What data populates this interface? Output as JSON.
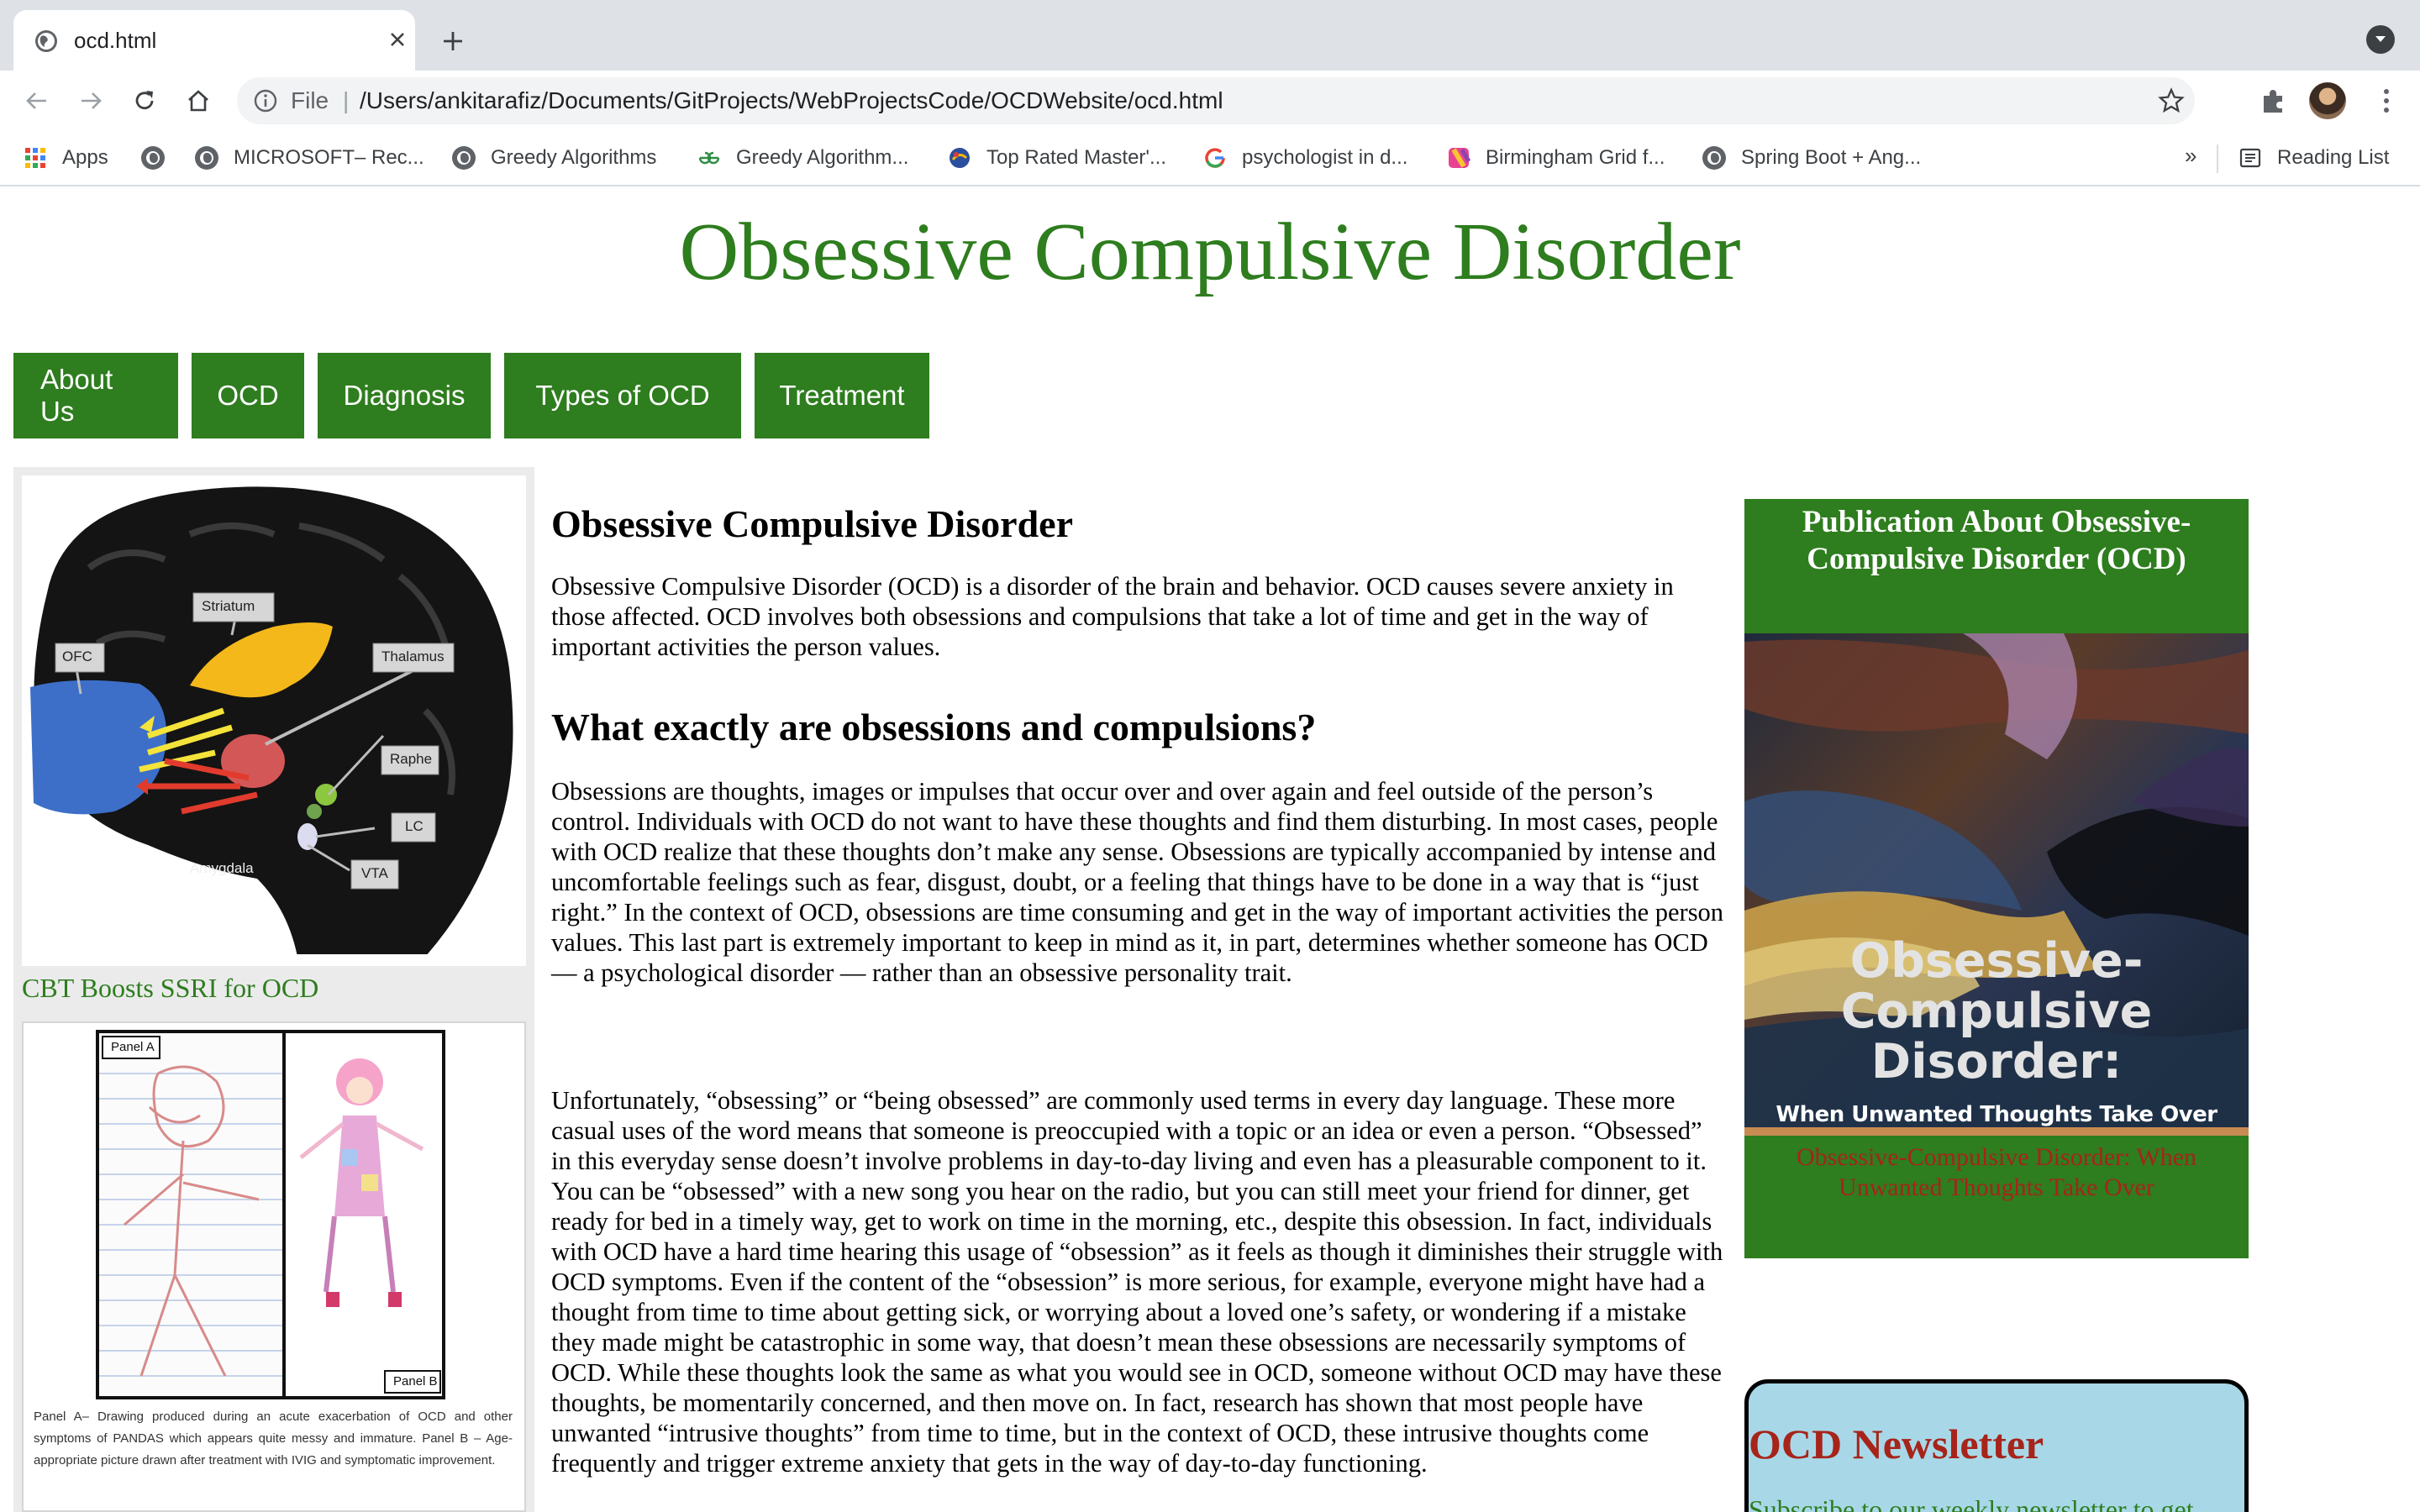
{
  "browser": {
    "tab_title": "ocd.html",
    "address_scheme": "File",
    "address_url": "/Users/ankitarafiz/Documents/GitProjects/WebProjectsCode/OCDWebsite/ocd.html",
    "bookmarks": [
      {
        "label": "Apps",
        "icon": "apps-grid-icon"
      },
      {
        "label": "",
        "icon": "globe-icon"
      },
      {
        "label": "MICROSOFT– Rec...",
        "icon": "globe-icon"
      },
      {
        "label": "Greedy Algorithms",
        "icon": "globe-icon"
      },
      {
        "label": "Greedy Algorithm...",
        "icon": "geeksforgeeks-icon"
      },
      {
        "label": "Top Rated Master'...",
        "icon": "site-icon"
      },
      {
        "label": "psychologist in d...",
        "icon": "google-icon"
      },
      {
        "label": "Birmingham Grid f...",
        "icon": "site-icon"
      },
      {
        "label": "Spring Boot + Ang...",
        "icon": "globe-icon"
      }
    ],
    "bookmarks_more": "»",
    "reading_list": "Reading List"
  },
  "page": {
    "site_title": "Obsessive Compulsive Disorder",
    "nav": [
      "About Us",
      "OCD",
      "Diagnosis",
      "Types of OCD",
      "Treatment"
    ],
    "left": {
      "figure1_labels": {
        "ofc": "OFC",
        "striatum": "Striatum",
        "thalamus": "Thalamus",
        "raphe": "Raphe",
        "lc": "LC",
        "vta": "VTA",
        "amygdala": "Amygdala"
      },
      "figure1_caption": "CBT Boosts SSRI for OCD",
      "figure2_labels": {
        "panel_a": "Panel A",
        "panel_b": "Panel B"
      },
      "figure2_caption": "Panel A– Drawing produced during an acute exacerbation of OCD and other symptoms of PANDAS which appears quite messy and immature. Panel B – Age-appropriate picture drawn after treatment with IVIG and symptomatic improvement."
    },
    "main": {
      "heading1": "Obsessive Compulsive Disorder",
      "para1": "Obsessive Compulsive Disorder (OCD) is a disorder of the brain and behavior. OCD causes severe anxiety in those affected. OCD involves both obsessions and compulsions that take a lot of time and get in the way of important activities the person values.",
      "heading2": "What exactly are obsessions and compulsions?",
      "para2": "Obsessions are thoughts, images or impulses that occur over and over again and feel outside of the person’s control. Individuals with OCD do not want to have these thoughts and find them disturbing. In most cases, people with OCD realize that these thoughts don’t make any sense. Obsessions are typically accompanied by intense and uncomfortable feelings such as fear, disgust, doubt, or a feeling that things have to be done in a way that is “just right.” In the context of OCD, obsessions are time consuming and get in the way of important activities the person values. This last part is extremely important to keep in mind as it, in part, determines whether someone has OCD — a psychological disorder — rather than an obsessive personality trait.",
      "para3": "Unfortunately, “obsessing” or “being obsessed” are commonly used terms in every day language. These more casual uses of the word means that someone is preoccupied with a topic or an idea or even a person. “Obsessed” in this everyday sense doesn’t involve problems in day-to-day living and even has a pleasurable component to it. You can be “obsessed” with a new song you hear on the radio, but you can still meet your friend for dinner, get ready for bed in a timely way, get to work on time in the morning, etc., despite this obsession. In fact, individuals with OCD have a hard time hearing this usage of “obsession” as it feels as though it diminishes their struggle with OCD symptoms. Even if the content of the “obsession” is more serious, for example, everyone might have had a thought from time to time about getting sick, or worrying about a loved one’s safety, or wondering if a mistake they made might be catastrophic in some way, that doesn’t mean these obsessions are necessarily symptoms of OCD. While these thoughts look the same as what you would see in OCD, someone without OCD may have these thoughts, be momentarily concerned, and then move on. In fact, research has shown that most people have unwanted “intrusive thoughts” from time to time, but in the context of OCD, these intrusive thoughts come frequently and trigger extreme anxiety that gets in the way of day-to-day functioning."
    },
    "sidebar": {
      "pub_title": "Publication About Obsessive-Compulsive Disorder (OCD)",
      "cover_title": "Obsessive-Compulsive Disorder:",
      "cover_subtitle": "When Unwanted Thoughts Take Over",
      "pub_link": "Obsessive-Compulsive Disorder: When Unwanted Thoughts Take Over",
      "newsletter_title": "OCD Newsletter",
      "newsletter_text": "Subscribe to our weekly newsletter to get"
    }
  },
  "colors": {
    "brand_green": "#2e7d1e",
    "link_red": "#a7241a",
    "newsletter_bg": "#a8d8e8"
  }
}
